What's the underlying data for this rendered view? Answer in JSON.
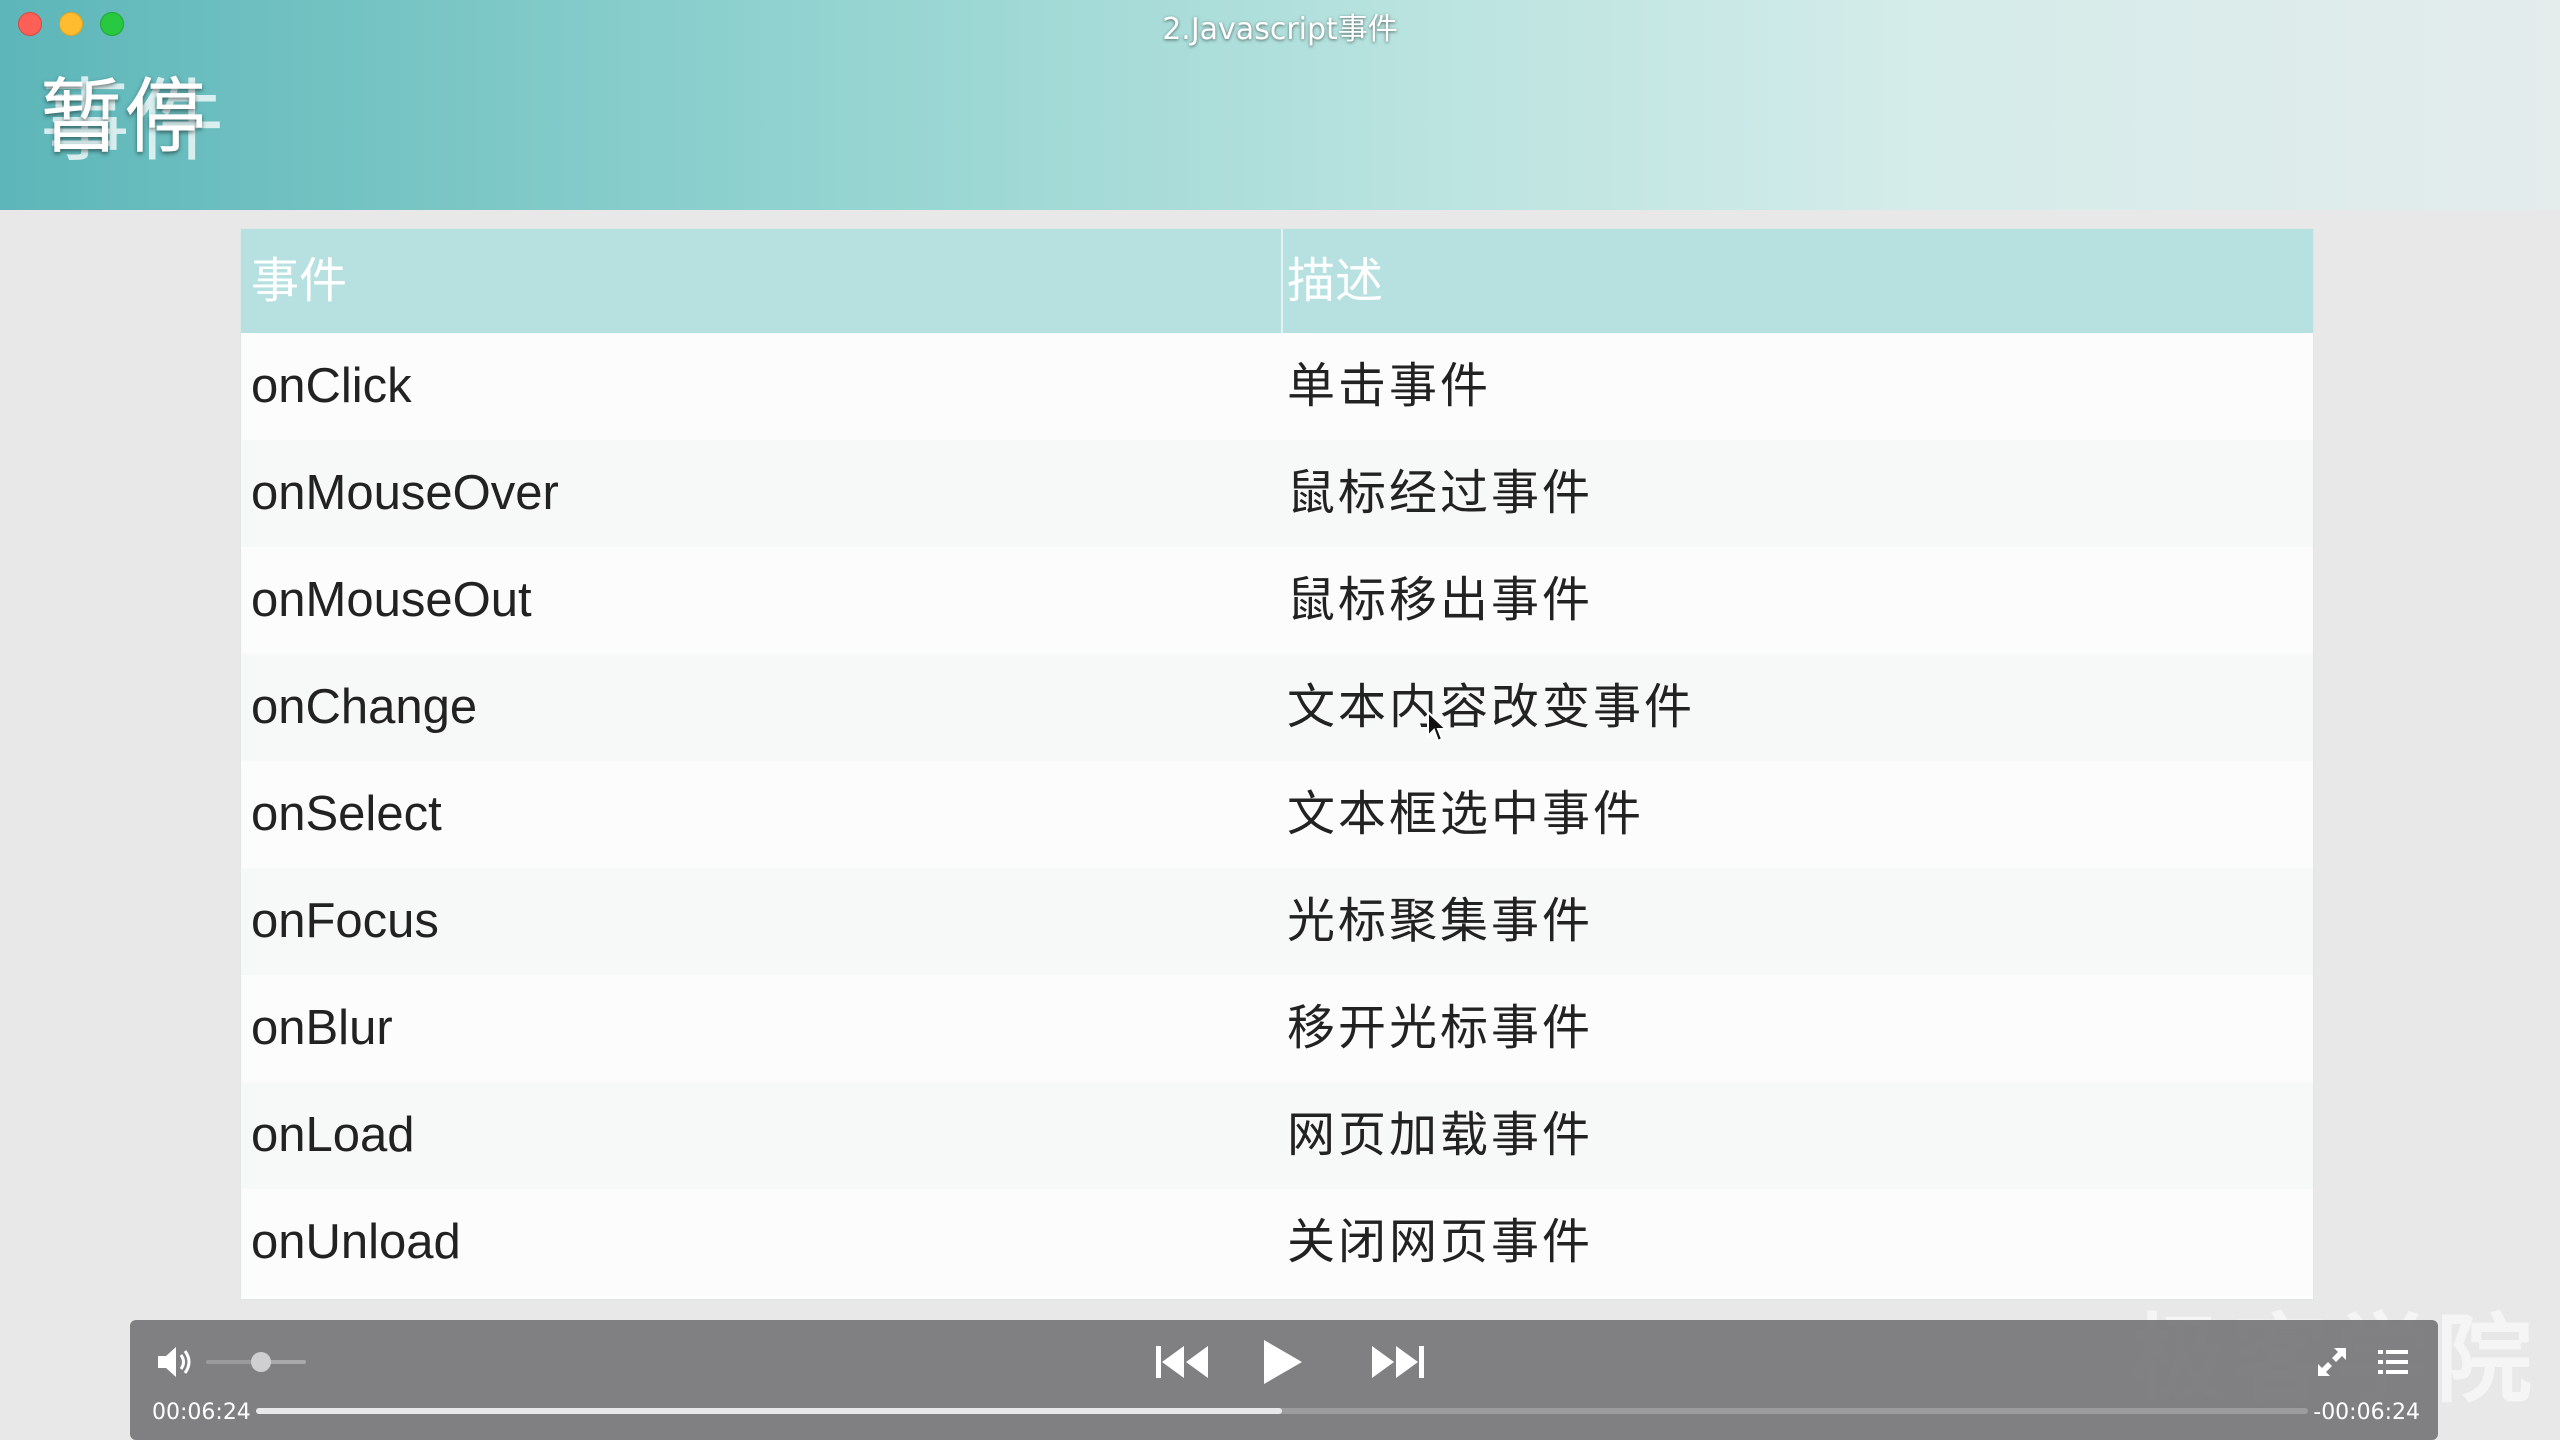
{
  "window": {
    "title": "2.Javascript事件"
  },
  "slide": {
    "title": "事件",
    "overlay_label": "暂停",
    "header_color": "#8fd2cf",
    "table": {
      "headers": [
        "事件",
        "描述"
      ],
      "rows": [
        {
          "event": "onClick",
          "desc": "单击事件"
        },
        {
          "event": "onMouseOver",
          "desc": "鼠标经过事件"
        },
        {
          "event": "onMouseOut",
          "desc": "鼠标移出事件"
        },
        {
          "event": "onChange",
          "desc": "文本内容改变事件"
        },
        {
          "event": "onSelect",
          "desc": "文本框选中事件"
        },
        {
          "event": "onFocus",
          "desc": "光标聚集事件"
        },
        {
          "event": "onBlur",
          "desc": "移开光标事件"
        },
        {
          "event": "onLoad",
          "desc": "网页加载事件"
        },
        {
          "event": "onUnload",
          "desc": "关闭网页事件"
        }
      ]
    }
  },
  "watermark": "极客学院",
  "player": {
    "current_time": "00:06:24",
    "remaining_time": "-00:06:24",
    "progress": 0.5,
    "volume": 0.55,
    "icons": {
      "volume": "speaker-icon",
      "prev": "skip-back-icon",
      "play": "play-icon",
      "next": "skip-forward-icon",
      "fullscreen": "fullscreen-icon",
      "playlist": "playlist-icon"
    }
  }
}
